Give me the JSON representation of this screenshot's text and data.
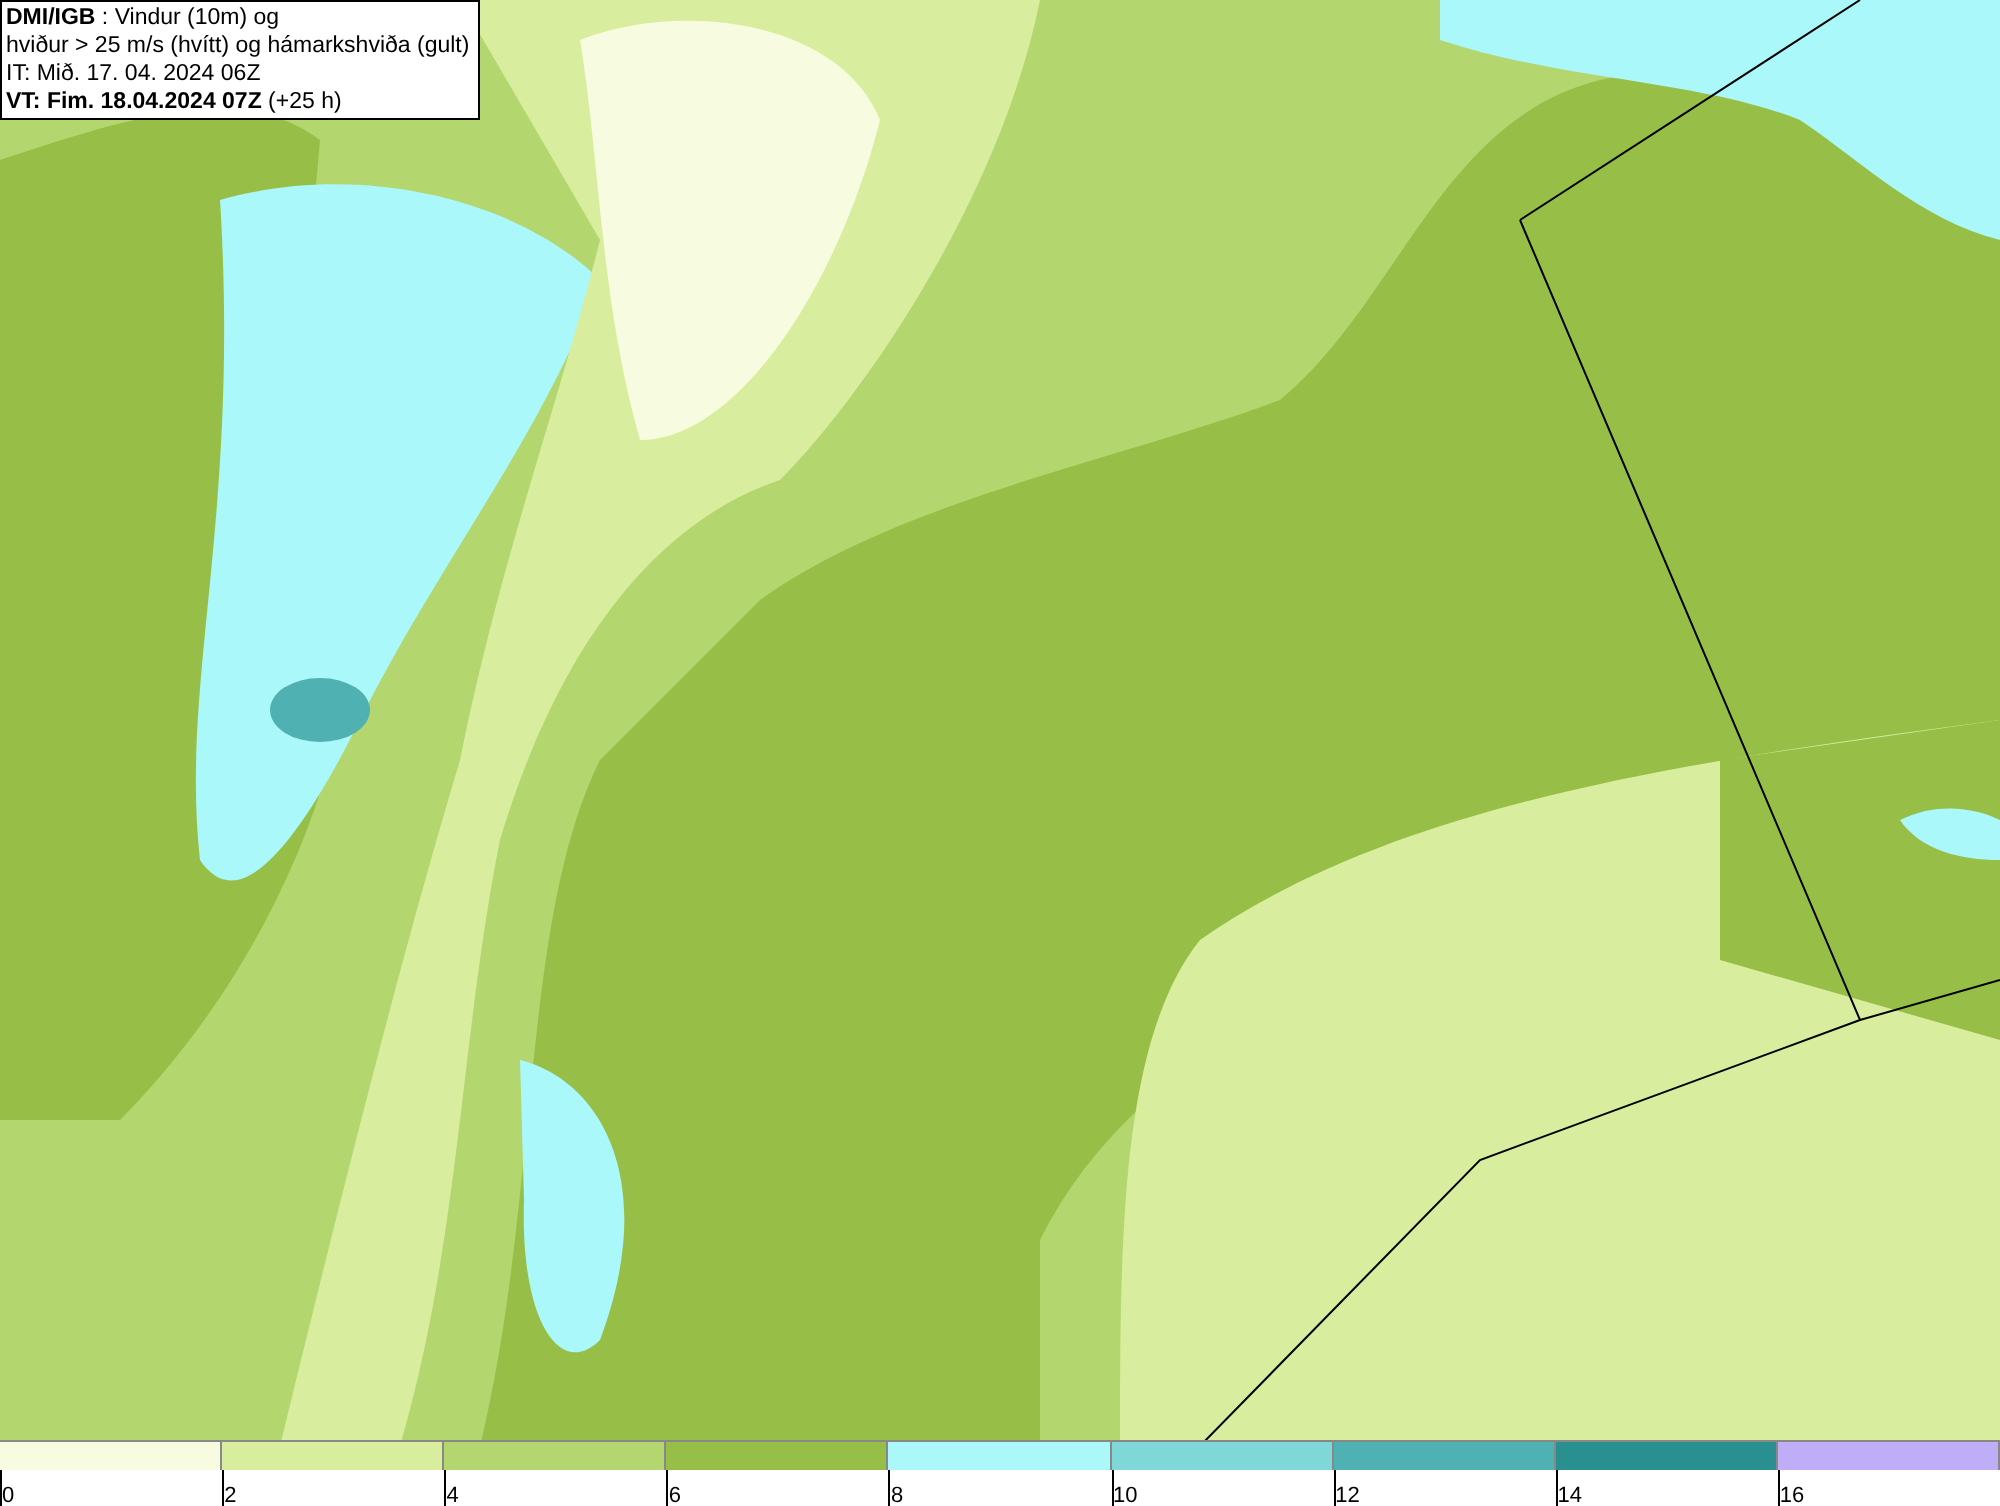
{
  "header": {
    "lines": [
      "**DMI/IGB** : Vindur (10m) og",
      "hviður > 25 m/s (hvítt) og hámarkshviða (gult)",
      "IT: Mið. 17. 04. 2024 06Z",
      "**VT: Fim. 18.04.2024 07Z** (+25 h)"
    ]
  },
  "legend": {
    "segments": [
      {
        "color": "#f7fce0",
        "label": "0"
      },
      {
        "color": "#d8ee9e",
        "label": "2"
      },
      {
        "color": "#b3d66e",
        "label": "4"
      },
      {
        "color": "#97bf47",
        "label": "6"
      },
      {
        "color": "#aaf8fa",
        "label": "8"
      },
      {
        "color": "#7fd8d8",
        "label": "10"
      },
      {
        "color": "#4fb1b1",
        "label": "12"
      },
      {
        "color": "#2a8f8f",
        "label": "14"
      },
      {
        "color": "#c0adf8",
        "label": "16"
      }
    ]
  }
}
